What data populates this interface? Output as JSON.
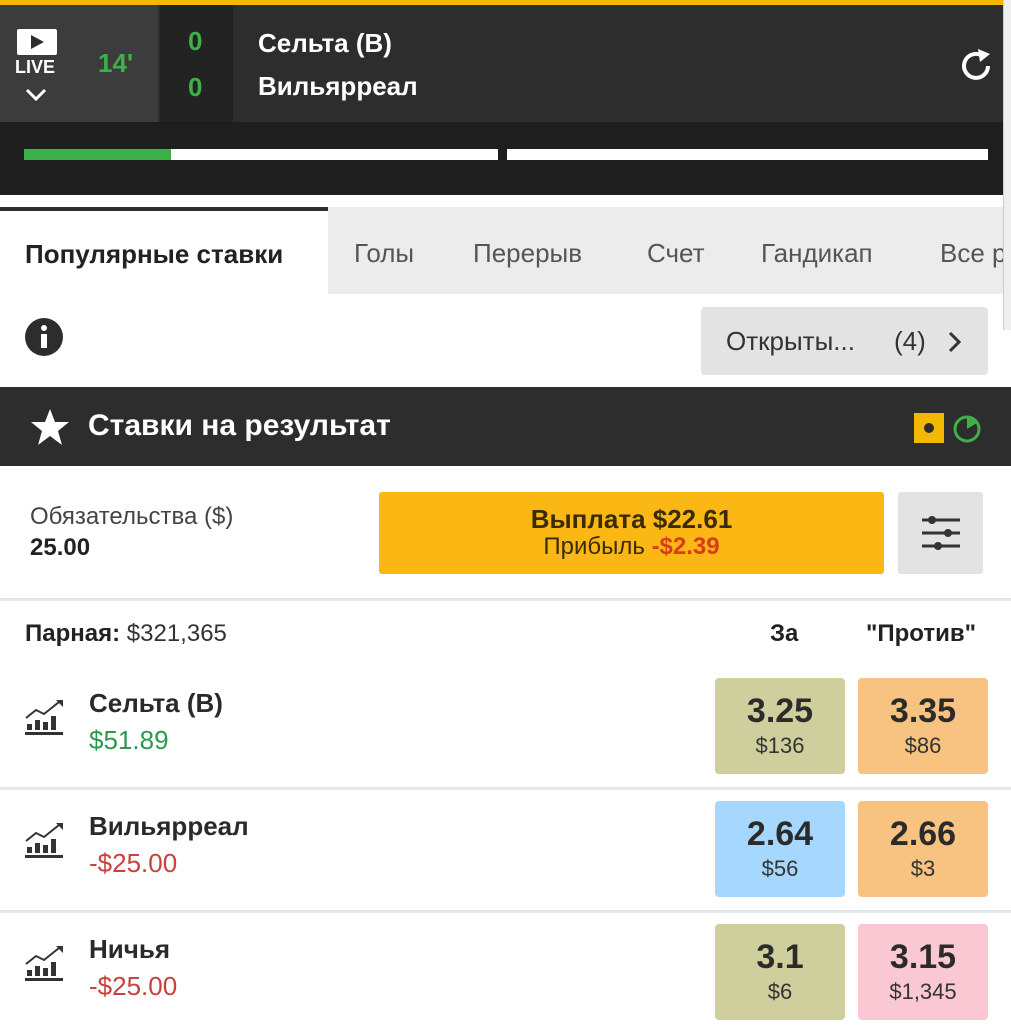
{
  "header": {
    "live_label": "LIVE",
    "minute": "14'",
    "home_score": "0",
    "away_score": "0",
    "home_team": "Сельта (В)",
    "away_team": "Вильярреал",
    "progress_first_half": 0.31,
    "progress_second_half": 0.0,
    "colors": {
      "accent": "#3db04a",
      "header_bg": "#2d2d2d",
      "top_line": "#f5b800"
    }
  },
  "tabs": [
    {
      "label": "Популярные ставки",
      "active": true
    },
    {
      "label": "Голы",
      "active": false
    },
    {
      "label": "Перерыв",
      "active": false
    },
    {
      "label": "Счет",
      "active": false
    },
    {
      "label": "Гандикап",
      "active": false
    },
    {
      "label": "Все р",
      "active": false
    }
  ],
  "open_bets": {
    "label": "Открыты...",
    "count": "(4)"
  },
  "section": {
    "title": "Ставки на результат",
    "icons": [
      "star-icon",
      "in-play-icon",
      "clock-icon"
    ]
  },
  "liability": {
    "label": "Обязательства ($)",
    "value": "25.00"
  },
  "payout": {
    "line1": "Выплата $22.61",
    "profit_label": "Прибыль",
    "profit_value": "-$2.39",
    "color": "#fbb814"
  },
  "market": {
    "matched_label": "Парная:",
    "matched_value": "$321,365",
    "back_header": "За",
    "lay_header": "\"Против\""
  },
  "runners": [
    {
      "name": "Сельта (В)",
      "pnl": "$51.89",
      "pnl_positive": true,
      "back": {
        "price": "3.25",
        "stake": "$136",
        "color": "#cfcf9e"
      },
      "lay": {
        "price": "3.35",
        "stake": "$86",
        "color": "#f8c280"
      }
    },
    {
      "name": "Вильярреал",
      "pnl": "-$25.00",
      "pnl_positive": false,
      "back": {
        "price": "2.64",
        "stake": "$56",
        "color": "#a6d8ff"
      },
      "lay": {
        "price": "2.66",
        "stake": "$3",
        "color": "#f8c280"
      }
    },
    {
      "name": "Ничья",
      "pnl": "-$25.00",
      "pnl_positive": false,
      "back": {
        "price": "3.1",
        "stake": "$6",
        "color": "#cfcf9e"
      },
      "lay": {
        "price": "3.15",
        "stake": "$1,345",
        "color": "#fac8d2"
      }
    }
  ]
}
